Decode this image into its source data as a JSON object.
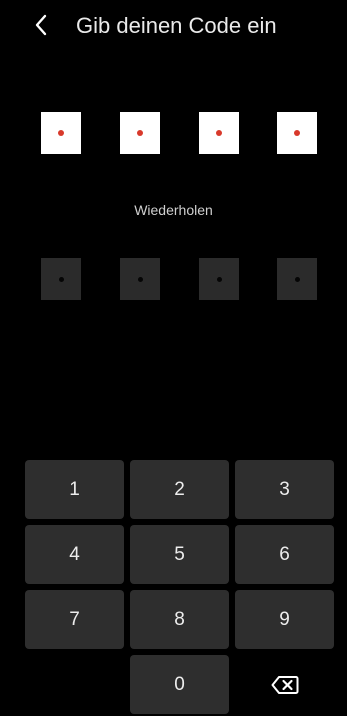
{
  "header": {
    "back_icon": "chevron-left-icon",
    "title": "Gib deinen Code ein"
  },
  "code_entry": {
    "digits_entered": 4,
    "length": 4,
    "dot_color": "#d8392b"
  },
  "repeat": {
    "label": "Wiederholen",
    "digits_entered": 0,
    "length": 4
  },
  "keypad": {
    "keys": [
      "1",
      "2",
      "3",
      "4",
      "5",
      "6",
      "7",
      "8",
      "9",
      "",
      "0"
    ],
    "delete_icon": "backspace-icon"
  },
  "colors": {
    "background": "#000000",
    "key_background": "#2e2e2e",
    "filled_box": "#ffffff",
    "empty_box": "#2b2b2b",
    "accent_dot": "#d8392b"
  }
}
